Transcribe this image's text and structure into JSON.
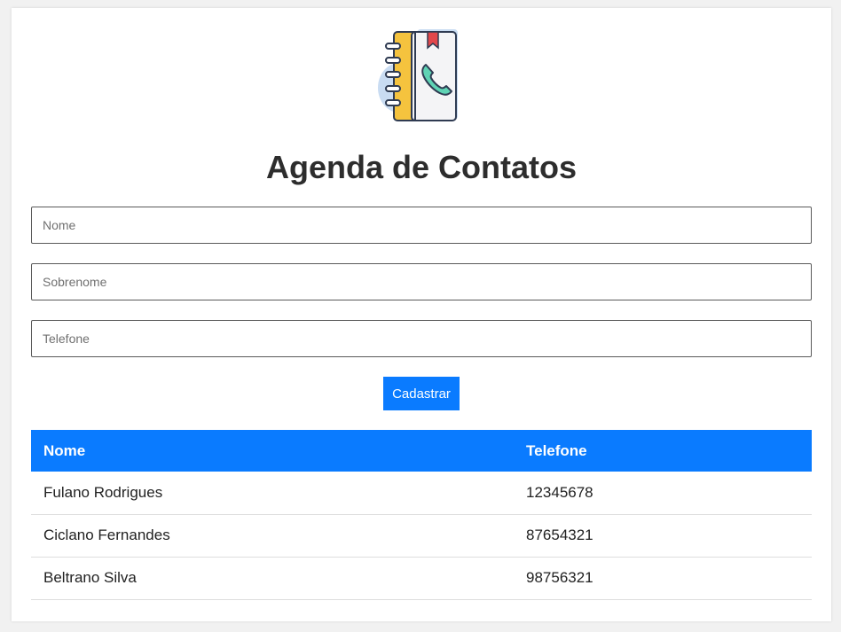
{
  "app": {
    "title": "Agenda de Contatos",
    "logo_icon": "address-book-phone-icon"
  },
  "form": {
    "nome_placeholder": "Nome",
    "sobrenome_placeholder": "Sobrenome",
    "telefone_placeholder": "Telefone",
    "nome_value": "",
    "sobrenome_value": "",
    "telefone_value": "",
    "submit_label": "Cadastrar"
  },
  "table": {
    "headers": [
      "Nome",
      "Telefone"
    ],
    "rows": [
      {
        "nome": "Fulano Rodrigues",
        "telefone": "12345678"
      },
      {
        "nome": "Ciclano Fernandes",
        "telefone": "87654321"
      },
      {
        "nome": "Beltrano Silva",
        "telefone": "98756321"
      }
    ]
  },
  "colors": {
    "accent": "#0a7bff",
    "title": "#2d2d2d",
    "background": "#f1f1f1"
  }
}
